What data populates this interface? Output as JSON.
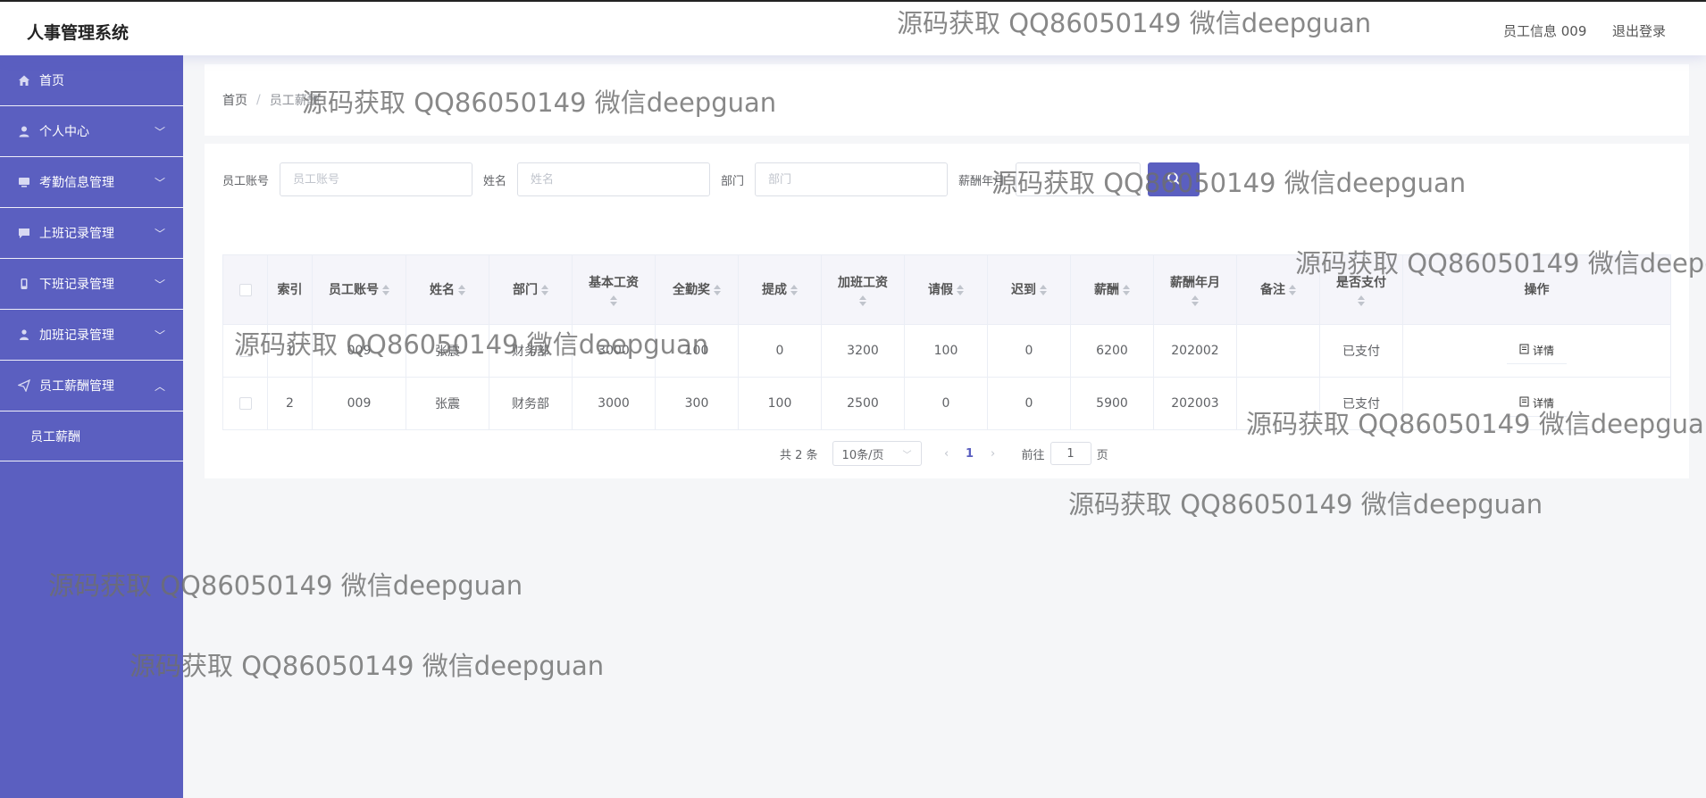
{
  "header": {
    "app_title": "人事管理系统",
    "user_label": "员工信息 009",
    "logout_label": "退出登录"
  },
  "sidebar": {
    "items": [
      {
        "label": "首页",
        "icon": "home-icon"
      },
      {
        "label": "个人中心",
        "icon": "user-icon"
      },
      {
        "label": "考勤信息管理",
        "icon": "monitor-icon"
      },
      {
        "label": "上班记录管理",
        "icon": "chat-icon"
      },
      {
        "label": "下班记录管理",
        "icon": "phone-icon"
      },
      {
        "label": "加班记录管理",
        "icon": "person-icon"
      },
      {
        "label": "员工薪酬管理",
        "icon": "send-icon"
      }
    ],
    "sub_item": "员工薪酬"
  },
  "breadcrumb": {
    "home": "首页",
    "separator": "/",
    "current": "员工薪酬"
  },
  "search": {
    "fields": [
      {
        "label": "员工账号",
        "placeholder": "员工账号"
      },
      {
        "label": "姓名",
        "placeholder": "姓名"
      },
      {
        "label": "部门",
        "placeholder": "部门"
      },
      {
        "label": "薪酬年月",
        "placeholder": ""
      }
    ]
  },
  "table": {
    "headers": [
      "索引",
      "员工账号",
      "姓名",
      "部门",
      "基本工资",
      "全勤奖",
      "提成",
      "加班工资",
      "请假",
      "迟到",
      "薪酬",
      "薪酬年月",
      "备注",
      "是否支付",
      "操作"
    ],
    "rows": [
      [
        "1",
        "009",
        "张震",
        "财务部",
        "3000",
        "100",
        "0",
        "3200",
        "100",
        "0",
        "6200",
        "202002",
        "",
        "已支付"
      ],
      [
        "2",
        "009",
        "张震",
        "财务部",
        "3000",
        "300",
        "100",
        "2500",
        "0",
        "0",
        "5900",
        "202003",
        "",
        "已支付"
      ]
    ],
    "detail_label": "详情"
  },
  "pagination": {
    "total": "共 2 条",
    "page_size": "10条/页",
    "current_page": "1",
    "goto_label": "前往",
    "goto_value": "1",
    "page_suffix": "页"
  },
  "watermark": "源码获取 QQ86050149 微信deepguan"
}
